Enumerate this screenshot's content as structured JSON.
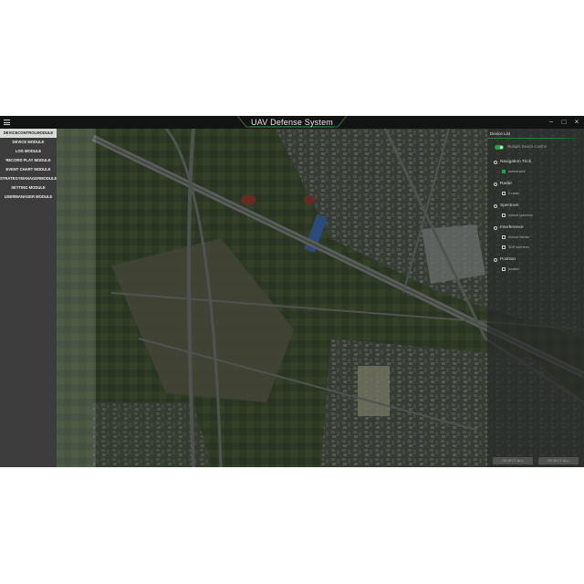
{
  "window": {
    "title": "UAV Defense System",
    "menu_icon": "hamburger-menu-icon",
    "controls": [
      "−",
      "□",
      "×"
    ]
  },
  "sidebar": {
    "items": [
      {
        "label": "DEVICECONTROLMODULE",
        "active": true
      },
      {
        "label": "DEVICE MODULE",
        "active": false
      },
      {
        "label": "LOG MODULE",
        "active": false
      },
      {
        "label": "RECORD PLAY MODULE",
        "active": false
      },
      {
        "label": "EVENT CHART MODULE",
        "active": false
      },
      {
        "label": "STRATEGYMANAGERMODULE",
        "active": false
      },
      {
        "label": "SETTING MODULE",
        "active": false
      },
      {
        "label": "USERMANAGER MODULE",
        "active": false
      }
    ]
  },
  "device_panel": {
    "title": "Device List",
    "toggle": {
      "label": "Multiple Device Control",
      "on": true
    },
    "groups": [
      {
        "name": "Navigation Trick",
        "options": [
          {
            "label": "normal trick",
            "checked": true
          }
        ]
      },
      {
        "name": "Radar",
        "options": [
          {
            "label": "S radar",
            "checked": false
          }
        ]
      },
      {
        "name": "Spectrum",
        "options": [
          {
            "label": "normal spectrum",
            "checked": false
          }
        ]
      },
      {
        "name": "Interference",
        "options": [
          {
            "label": "normal interfer",
            "checked": false
          },
          {
            "label": "SDR interferer",
            "checked": false
          }
        ]
      },
      {
        "name": "Position",
        "options": [
          {
            "label": "position",
            "checked": false
          }
        ]
      }
    ],
    "buttons": {
      "left": "REJECT ALL",
      "right": "REJECT ALL"
    }
  },
  "colors": {
    "accent_green": "#27a23c",
    "titlebar": "#121313",
    "sidebar": "#3b3c3b"
  }
}
